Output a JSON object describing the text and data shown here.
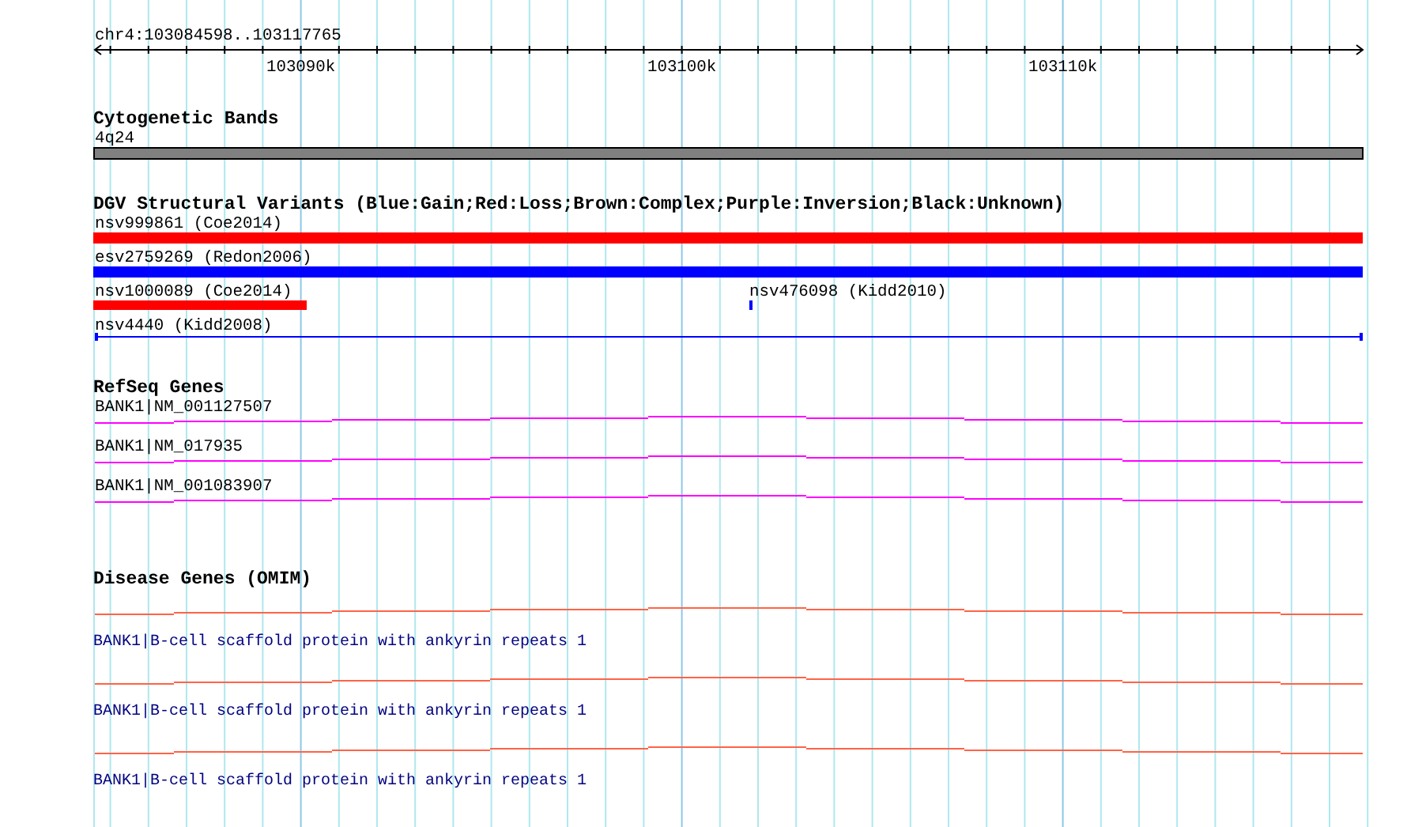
{
  "ruler": {
    "location": "chr4:103084598..103117765",
    "tick_labels": [
      "103090k",
      "103100k",
      "103110k"
    ]
  },
  "tracks": [
    {
      "kind": "bands",
      "title": "Cytogenetic Bands",
      "features": [
        {
          "label": "4q24"
        }
      ]
    },
    {
      "kind": "variants",
      "title": "DGV Structural Variants (Blue:Gain;Red:Loss;Brown:Complex;Purple:Inversion;Black:Unknown)",
      "features": [
        {
          "label": "nsv999861 (Coe2014)",
          "color": "#ff0000"
        },
        {
          "label": "esv2759269 (Redon2006)",
          "color": "#0000ff"
        },
        {
          "label": "nsv1000089 (Coe2014)",
          "color": "#ff0000"
        },
        {
          "label": "nsv476098 (Kidd2010)",
          "color": "#0000ff"
        },
        {
          "label": "nsv4440 (Kidd2008)",
          "color": "#0000ff"
        }
      ]
    },
    {
      "kind": "genes",
      "title": "RefSeq Genes",
      "features": [
        {
          "label": "BANK1|NM_001127507"
        },
        {
          "label": "BANK1|NM_017935"
        },
        {
          "label": "BANK1|NM_001083907"
        }
      ]
    },
    {
      "kind": "disease",
      "title": "Disease Genes (OMIM)",
      "features": [
        {
          "label": "BANK1|B-cell scaffold protein with ankyrin repeats 1"
        },
        {
          "label": "BANK1|B-cell scaffold protein with ankyrin repeats 1"
        },
        {
          "label": "BANK1|B-cell scaffold protein with ankyrin repeats 1"
        }
      ]
    }
  ]
}
